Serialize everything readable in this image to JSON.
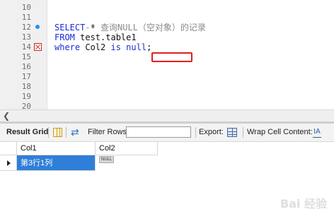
{
  "editor": {
    "lines": [
      {
        "num": "10",
        "marker": ""
      },
      {
        "num": "11",
        "marker": ""
      },
      {
        "num": "12",
        "marker": "dot"
      },
      {
        "num": "13",
        "marker": ""
      },
      {
        "num": "14",
        "marker": "error"
      },
      {
        "num": "15",
        "marker": ""
      },
      {
        "num": "16",
        "marker": ""
      },
      {
        "num": "17",
        "marker": ""
      },
      {
        "num": "18",
        "marker": ""
      },
      {
        "num": "19",
        "marker": ""
      },
      {
        "num": "20",
        "marker": ""
      }
    ],
    "comment": "-- 查询NULL（空对象）的记录",
    "line12_kw": "SELECT",
    "line12_rest": " *",
    "line13_kw": "FROM",
    "line13_rest": " test.table1",
    "line14_kw1": "where",
    "line14_ident": " Col2 ",
    "line14_kw2": "is",
    "line14_sp": " ",
    "line14_kw3": "null",
    "line14_end": ";"
  },
  "toolbar": {
    "result_grid_label": "Result Grid",
    "filter_rows_label": "Filter Rows:",
    "filter_value": "",
    "export_label": "Export:",
    "wrap_label": "Wrap Cell Content:",
    "wrap_icon_glyph": "IA"
  },
  "grid": {
    "columns": [
      "Col1",
      "Col2"
    ],
    "rows": [
      {
        "col1": "第3行1列",
        "col2": "NULL"
      }
    ]
  },
  "watermark": "Bai 经验",
  "icons": {
    "hscroll": "chevron-left-icon",
    "result_grid": "grid-icon",
    "refresh": "refresh-icon",
    "export": "export-icon",
    "wrap": "wrap-text-icon"
  },
  "colors": {
    "keyword": "#1a2bd6",
    "comment": "#8a8a8a",
    "highlight_box": "#e0201f",
    "selection": "#2f7fd8",
    "line_marker_dot": "#1e90ff",
    "line_marker_error": "#c62828"
  }
}
